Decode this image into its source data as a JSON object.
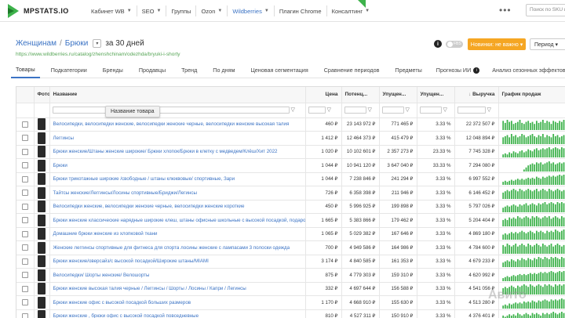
{
  "brand": {
    "logo_text": "MPSTATS.IO",
    "accent": "#3db24b",
    "link_color": "#3b73c4"
  },
  "topnav": {
    "items": [
      {
        "label": "Кабинет WB",
        "caret": true,
        "active": false
      },
      {
        "label": "SEO",
        "caret": true,
        "active": false
      },
      {
        "label": "Группы",
        "caret": false,
        "active": false
      },
      {
        "label": "Ozon",
        "caret": true,
        "active": false
      },
      {
        "label": "Wildberries",
        "caret": true,
        "active": true
      },
      {
        "label": "Плагин Chrome",
        "caret": false,
        "active": false
      },
      {
        "label": "Консалтинг",
        "caret": true,
        "active": false
      }
    ],
    "new_flag": "NEW",
    "more": "•••",
    "search_placeholder": "Поиск по SKU или"
  },
  "breadcrumb": {
    "level1": "Женщинам",
    "separator": "/",
    "level2": "Брюки",
    "dropdown": "▾",
    "period": "за 30 дней"
  },
  "url": "https://www.wildberries.ru/catalog/zhenshchinam/odezhda/bryuki-i-shorty",
  "controls": {
    "info": "i",
    "toggle_label": "FBS",
    "new_button": "Новинки: не важно ▾",
    "period_button": "Период ▾"
  },
  "tabs": [
    "Товары",
    "Подкатегории",
    "Бренды",
    "Продавцы",
    "Тренд",
    "По дням",
    "Ценовая сегментация",
    "Сравнение периодов",
    "Предметы",
    "Прогнозы ИИ",
    "Анализ сезонных эффектов"
  ],
  "table": {
    "headers": {
      "photo": "Фото",
      "name": "Название",
      "price": "Цена",
      "potential": "Потенц...",
      "lost": "Упущен...",
      "lost_pct": "Упущен...",
      "revenue": "Выручка",
      "chart": "График продаж"
    },
    "sort_indicator": "↓",
    "tooltip": "Название товара",
    "rows": [
      {
        "name": "Велосипедки, велосипедки женские, велосипедки женские черные, велосипедки женские высокая талия",
        "price": "460 ₽",
        "potential": "23 143 972 ₽",
        "lost": "771 465 ₽",
        "lost_pct": "3.33 %",
        "revenue": "22 372 507 ₽",
        "spark": [
          9,
          7,
          10,
          8,
          9,
          6,
          7,
          8,
          10,
          7,
          6,
          8,
          9,
          7,
          8,
          6,
          9,
          7,
          8,
          10,
          7,
          9,
          8,
          6,
          9,
          8,
          7,
          9,
          8,
          10
        ]
      },
      {
        "name": "Леггинсы",
        "price": "1 412 ₽",
        "potential": "12 464 373 ₽",
        "lost": "415 479 ₽",
        "lost_pct": "3.33 %",
        "revenue": "12 048 894 ₽",
        "spark": [
          6,
          7,
          8,
          6,
          9,
          7,
          8,
          6,
          7,
          9,
          8,
          6,
          7,
          8,
          9,
          7,
          6,
          8,
          7,
          9,
          6,
          8,
          7,
          6,
          9,
          7,
          8,
          6,
          7,
          8
        ]
      },
      {
        "name": "Брюки женские/Штаны женские широкие/ Брюки хлопок/Брюки в клетку с медведем/Клёш/Хит 2022",
        "price": "1 020 ₽",
        "potential": "10 102 601 ₽",
        "lost": "2 357 273 ₽",
        "lost_pct": "23.33 %",
        "revenue": "7 745 328 ₽",
        "spark": [
          3,
          4,
          3,
          5,
          4,
          6,
          5,
          4,
          6,
          7,
          5,
          6,
          8,
          7,
          6,
          8,
          9,
          7,
          8,
          9,
          8,
          9,
          10,
          8,
          9,
          10,
          9,
          8,
          10,
          9
        ]
      },
      {
        "name": "Брюки",
        "price": "1 044 ₽",
        "potential": "10 941 120 ₽",
        "lost": "3 647 040 ₽",
        "lost_pct": "33.33 %",
        "revenue": "7 294 080 ₽",
        "spark": [
          0,
          0,
          0,
          0,
          0,
          0,
          0,
          0,
          0,
          0,
          2,
          4,
          6,
          7,
          8,
          7,
          9,
          8,
          9,
          7,
          8,
          9,
          10,
          8,
          9,
          7,
          8,
          9,
          8,
          9
        ]
      },
      {
        "name": "Брюки трикотажные широкие /свободные / штаны клюквовые/ спортивные, Зари",
        "price": "1 044 ₽",
        "potential": "7 238 846 ₽",
        "lost": "241 294 ₽",
        "lost_pct": "3.33 %",
        "revenue": "6 997 552 ₽",
        "spark": [
          3,
          4,
          3,
          4,
          5,
          4,
          5,
          6,
          5,
          6,
          5,
          6,
          7,
          6,
          7,
          6,
          8,
          7,
          6,
          8,
          7,
          8,
          9,
          8,
          9,
          8,
          9,
          10,
          9,
          10
        ]
      },
      {
        "name": "Тайтсы женские/Леггинсы/Лосины спортивные/Бриджи/Легинсы",
        "price": "726 ₽",
        "potential": "6 358 398 ₽",
        "lost": "211 946 ₽",
        "lost_pct": "3.33 %",
        "revenue": "6 146 452 ₽",
        "spark": [
          5,
          6,
          7,
          6,
          7,
          8,
          7,
          6,
          8,
          7,
          6,
          7,
          8,
          7,
          6,
          7,
          8,
          6,
          7,
          8,
          7,
          6,
          8,
          7,
          6,
          7,
          8,
          7,
          6,
          7
        ]
      },
      {
        "name": "Велосипедки женские, велосипедки женские черные, велосипедки женские короткие",
        "price": "450 ₽",
        "potential": "5 996 925 ₽",
        "lost": "199 898 ₽",
        "lost_pct": "3.33 %",
        "revenue": "5 797 026 ₽",
        "spark": [
          4,
          5,
          6,
          5,
          6,
          7,
          6,
          5,
          7,
          6,
          7,
          8,
          6,
          7,
          8,
          7,
          6,
          8,
          7,
          8,
          9,
          7,
          8,
          9,
          8,
          7,
          9,
          8,
          9,
          8
        ]
      },
      {
        "name": "Брюки женские классические нарядные широкие клеш, штаны офисные школьные с высокой посадкой, подарок",
        "price": "1 665 ₽",
        "potential": "5 383 866 ₽",
        "lost": "179 462 ₽",
        "lost_pct": "3.33 %",
        "revenue": "5 204 404 ₽",
        "spark": [
          5,
          6,
          5,
          7,
          6,
          7,
          6,
          8,
          7,
          6,
          7,
          8,
          7,
          6,
          8,
          7,
          8,
          7,
          6,
          7,
          8,
          7,
          8,
          6,
          7,
          8,
          7,
          6,
          8,
          7
        ]
      },
      {
        "name": "Домашние брюки женские из хлопковой ткани",
        "price": "1 065 ₽",
        "potential": "5 029 382 ₽",
        "lost": "167 646 ₽",
        "lost_pct": "3.33 %",
        "revenue": "4 869 180 ₽",
        "spark": [
          4,
          5,
          4,
          5,
          6,
          5,
          6,
          5,
          6,
          7,
          6,
          5,
          6,
          7,
          6,
          5,
          7,
          6,
          7,
          6,
          5,
          7,
          6,
          7,
          6,
          8,
          7,
          6,
          7,
          8
        ]
      },
      {
        "name": "Женские леггинсы спортивные для фитнеса для спорта лосины женские с лампасами 3 полоски одежда",
        "price": "700 ₽",
        "potential": "4 949 586 ₽",
        "lost": "164 986 ₽",
        "lost_pct": "3.33 %",
        "revenue": "4 784 600 ₽",
        "spark": [
          6,
          5,
          7,
          6,
          5,
          6,
          7,
          5,
          6,
          7,
          6,
          5,
          7,
          6,
          5,
          6,
          7,
          6,
          5,
          7,
          6,
          5,
          6,
          7,
          5,
          6,
          7,
          6,
          5,
          6
        ]
      },
      {
        "name": "Брюки женские/оверсайз/с высокой посадкой/Широкие штаны/MIAMI",
        "price": "3 174 ₽",
        "potential": "4 840 585 ₽",
        "lost": "161 353 ₽",
        "lost_pct": "3.33 %",
        "revenue": "4 679 233 ₽",
        "spark": [
          4,
          5,
          6,
          5,
          7,
          6,
          5,
          7,
          6,
          8,
          7,
          6,
          8,
          7,
          6,
          8,
          7,
          9,
          8,
          7,
          9,
          8,
          7,
          9,
          8,
          9,
          8,
          7,
          9,
          8
        ]
      },
      {
        "name": "Велосипедки/ Шорты женские/ Велошорты",
        "price": "875 ₽",
        "potential": "4 779 303 ₽",
        "lost": "159 310 ₽",
        "lost_pct": "3.33 %",
        "revenue": "4 620 992 ₽",
        "spark": [
          3,
          4,
          5,
          4,
          5,
          6,
          5,
          6,
          7,
          6,
          7,
          6,
          7,
          8,
          7,
          8,
          7,
          8,
          9,
          8,
          9,
          8,
          9,
          10,
          9,
          8,
          9,
          10,
          9,
          10
        ]
      },
      {
        "name": "Брюки женские высокая талия черные / Леггинсы / Шорты / Лосины / Капри / Легинсы",
        "price": "332 ₽",
        "potential": "4 697 644 ₽",
        "lost": "156 588 ₽",
        "lost_pct": "3.33 %",
        "revenue": "4 541 056 ₽",
        "spark": [
          5,
          6,
          5,
          6,
          7,
          6,
          5,
          7,
          6,
          7,
          8,
          7,
          6,
          8,
          7,
          6,
          7,
          8,
          7,
          6,
          8,
          7,
          8,
          7,
          6,
          8,
          7,
          8,
          7,
          8
        ]
      },
      {
        "name": "Брюки женские офис с высокой посадкой больших размеров",
        "price": "1 170 ₽",
        "potential": "4 668 910 ₽",
        "lost": "155 630 ₽",
        "lost_pct": "3.33 %",
        "revenue": "4 513 280 ₽",
        "spark": [
          3,
          4,
          3,
          5,
          4,
          5,
          6,
          5,
          6,
          5,
          7,
          6,
          7,
          6,
          8,
          7,
          6,
          8,
          7,
          8,
          9,
          8,
          7,
          9,
          8,
          9,
          8,
          9,
          10,
          9
        ]
      },
      {
        "name": "Брюки женские , брюки офис с высокой посадкой повседневные",
        "price": "810 ₽",
        "potential": "4 527 311 ₽",
        "lost": "150 910 ₽",
        "lost_pct": "3.33 %",
        "revenue": "4 376 401 ₽",
        "spark": [
          5,
          4,
          5,
          6,
          5,
          6,
          5,
          7,
          6,
          5,
          6,
          7,
          6,
          5,
          7,
          6,
          7,
          6,
          5,
          7,
          6,
          7,
          6,
          7,
          8,
          7,
          6,
          7,
          8,
          7
        ]
      }
    ]
  }
}
